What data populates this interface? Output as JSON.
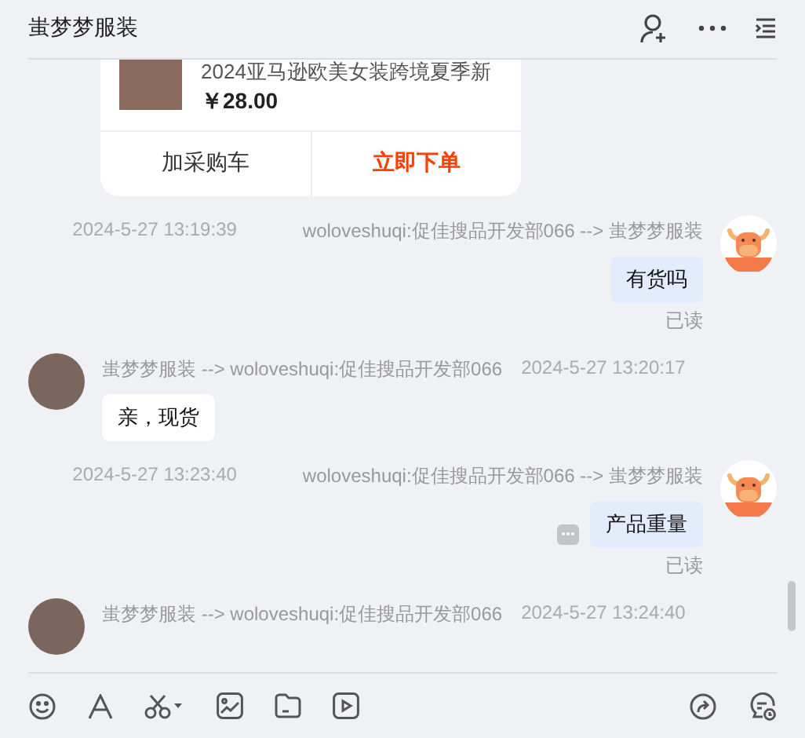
{
  "header": {
    "title": "蚩梦梦服装"
  },
  "product_card": {
    "title": "2024亚马逊欧美女装跨境夏季新",
    "price": "￥28.00",
    "actions": [
      {
        "label": "加采购车",
        "kind": "secondary"
      },
      {
        "label": "立即下单",
        "kind": "primary"
      }
    ]
  },
  "messages": [
    {
      "kind": "outgoing",
      "time": "2024-5-27 13:19:39",
      "route": "woloveshuqi:促佳搜品开发部066 --> 蚩梦梦服装",
      "text": "有货吗",
      "status": "已读",
      "more": false
    },
    {
      "kind": "incoming",
      "time": "2024-5-27 13:20:17",
      "route": "蚩梦梦服装 --> woloveshuqi:促佳搜品开发部066",
      "text": "亲，现货"
    },
    {
      "kind": "outgoing",
      "time": "2024-5-27 13:23:40",
      "route": "woloveshuqi:促佳搜品开发部066 --> 蚩梦梦服装",
      "text": "产品重量",
      "status": "已读",
      "more": true
    },
    {
      "kind": "incoming",
      "time": "2024-5-27 13:24:40",
      "route": "蚩梦梦服装 --> woloveshuqi:促佳搜品开发部066"
    }
  ]
}
